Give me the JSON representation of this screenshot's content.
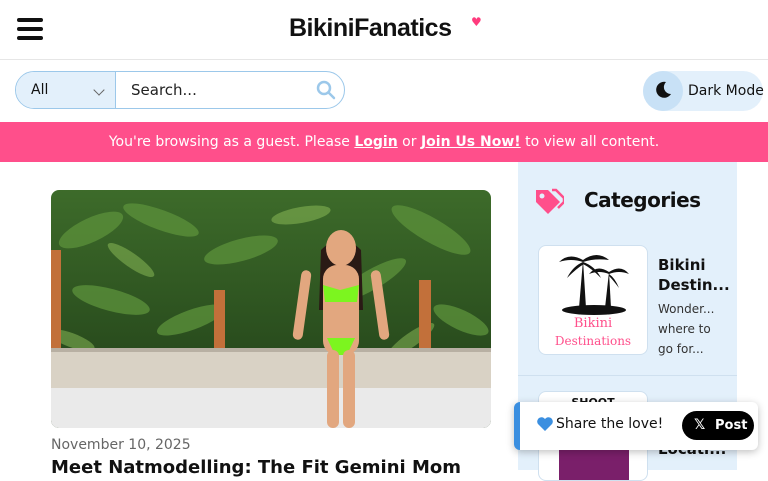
{
  "header": {
    "logo": "BikiniFanatics",
    "logo_heart": "♥"
  },
  "search": {
    "category_value": "All",
    "placeholder": "Search..."
  },
  "dark_mode": {
    "label": "Dark Mode"
  },
  "banner": {
    "prefix": "You're browsing as a guest. Please ",
    "login": "Login",
    "middle": " or ",
    "join": "Join Us Now!",
    "suffix": " to view all content."
  },
  "article": {
    "date": "November 10, 2025",
    "title": "Meet Natmodelling: The Fit Gemini Mom"
  },
  "sidebar": {
    "title": "Categories",
    "categories": [
      {
        "name": "Bikini Destin...",
        "description": "Wonder... where to go for...",
        "thumb_text_1": "Bikini",
        "thumb_text_2": "Destinations"
      },
      {
        "name": "Locati...",
        "thumb_label": "SHOOT"
      }
    ]
  },
  "share": {
    "text": "Share the love!",
    "x_label": "𝕏",
    "post_label": "Post"
  },
  "colors": {
    "banner": "#ff4f8b",
    "accent_blue": "#e3f0fb",
    "heart": "#ff3b7d"
  }
}
